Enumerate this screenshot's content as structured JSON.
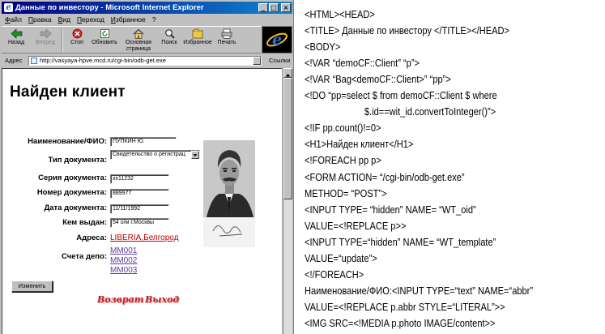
{
  "window": {
    "title": "Данные по инвестору - Microsoft Internet Explorer",
    "controls": [
      "_",
      "□",
      "×"
    ]
  },
  "menu": [
    "Файл",
    "Правка",
    "Вид",
    "Переход",
    "Избранное",
    "?"
  ],
  "toolbar": [
    {
      "label": "Назад",
      "icon": "back-arrow-icon",
      "enabled": true
    },
    {
      "label": "Вперед",
      "icon": "forward-arrow-icon",
      "enabled": false
    },
    {
      "label": "Стоп",
      "icon": "stop-icon",
      "enabled": true
    },
    {
      "label": "Обновить",
      "icon": "refresh-icon",
      "enabled": true
    },
    {
      "label": "Основная страница",
      "icon": "home-icon",
      "enabled": true
    },
    {
      "label": "Поиск",
      "icon": "search-icon",
      "enabled": true
    },
    {
      "label": "Избранное",
      "icon": "favorites-icon",
      "enabled": true
    },
    {
      "label": "Печать",
      "icon": "print-icon",
      "enabled": true
    }
  ],
  "address": {
    "label": "Адрес",
    "url": "http://vasyaya-hpve.mcd.ru/cgi-bin/odb-get.exe",
    "links_label": "Ссылки"
  },
  "page": {
    "title": "Найден клиент",
    "fields": {
      "name": {
        "label": "Наименование/ФИО:",
        "value": "ПУПКИН Ю."
      },
      "doc_type": {
        "label": "Тип документа:",
        "value": "Свидетельство о регистрац"
      },
      "doc_series": {
        "label": "Серия документа:",
        "value": "хх11232"
      },
      "doc_number": {
        "label": "Номер документа:",
        "value": "889977"
      },
      "doc_date": {
        "label": "Дата документа:",
        "value": "11/11/1992"
      },
      "issued_by": {
        "label": "Кем выдан:",
        "value": "54 о/м г.Москвы"
      }
    },
    "addresses": {
      "label": "Адреса:",
      "values": [
        "LIBERIA,Белгород"
      ]
    },
    "depo_accounts": {
      "label": "Счета депо:",
      "values": [
        "MM001",
        "MM002",
        "MM003"
      ]
    },
    "change_button": "Изменить",
    "back_link": "Возврат",
    "exit_link": "Выход"
  },
  "source_code": [
    "<HTML><HEAD>",
    "<TITLE> Данные по инвестору </TITLE></HEAD>",
    "<BODY>",
    "<!VAR “demoCF::Client” “p”>",
    "<!VAR “Bag<demoCF::Client>” “pp”>",
    "<!DO “pp=select $ from demoCF::Client $ where",
    "                        $.id==wit_id.convertToInteger()”>",
    "<!IF pp.count()!=0>",
    "<H1>Найден клиент</H1>",
    "<!FOREACH pp p>",
    "<FORM ACTION= “/cgi-bin/odb-get.exe”",
    "METHOD= “POST”>",
    "<INPUT TYPE= “hidden” NAME= “WT_oid”",
    "VALUE=<!REPLACE p>>",
    "<INPUT TYPE=“hidden” NAME= “WT_template”",
    "VALUE=“update”>",
    "<!/FOREACH>",
    "Наименование/ФИО:<INPUT TYPE=“text” NAME=“abbr”",
    "VALUE=<!REPLACE p.abbr STYLE=“LITERAL”>>",
    "<IMG SRC=<!MEDIA p.photo IMAGE/content>>"
  ]
}
